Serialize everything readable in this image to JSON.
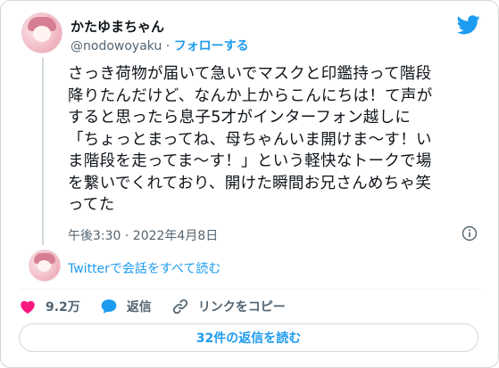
{
  "tweet": {
    "display_name": "かたゆまちゃん",
    "handle": "@nodowoyaku",
    "separator": "·",
    "follow_label": "フォローする",
    "text": "さっき荷物が届いて急いでマスクと印鑑持って階段\n降りたんだけど、なんか上からこんにちは！て声が\nすると思ったら息子5才がインターフォン越しに\n「ちょっとまってね、母ちゃんいま開けま〜す！い\nま階段を走ってま〜す！」という軽快なトークで場\nを繋いでくれており、開けた瞬間お兄さんめちゃ笑\nってた",
    "timestamp": "午後3:30 · 2022年4月8日",
    "see_conversation": "Twitterで会話をすべて読む",
    "likes": "9.2万",
    "reply_label": "返信",
    "copy_link_label": "リンクをコピー",
    "read_replies": "32件の返信を読む"
  },
  "colors": {
    "accent": "#1d9bf0",
    "like": "#f91880",
    "secondary_text": "#536471"
  },
  "icons": [
    "twitter-bird-icon",
    "info-icon",
    "heart-icon",
    "reply-bubble-icon",
    "link-icon"
  ]
}
